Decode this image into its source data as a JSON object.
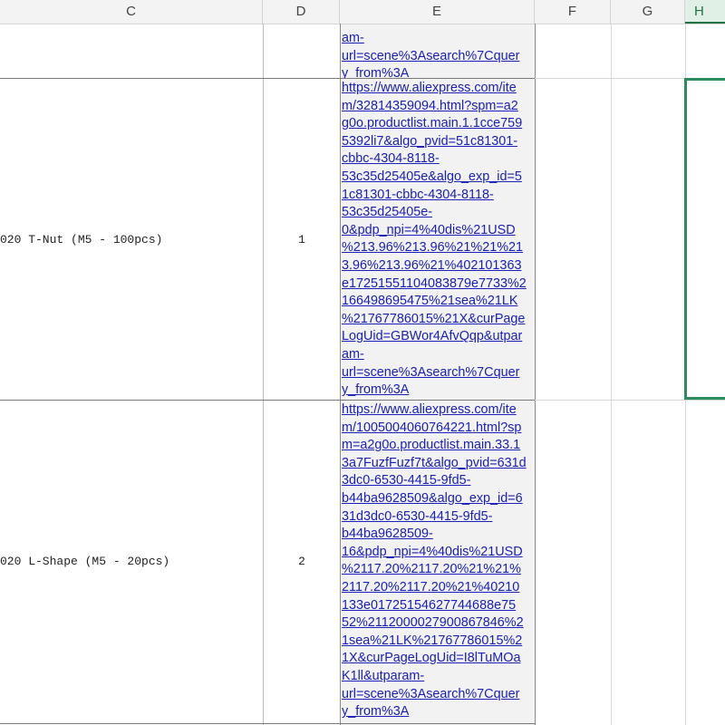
{
  "columns": {
    "c": "C",
    "d": "D",
    "e": "E",
    "f": "F",
    "g": "G",
    "h": "H"
  },
  "rows": [
    {
      "link_fragment": "am-\nurl=scene%3Asearch%7Cquer\ny_from%3A"
    },
    {
      "product": "020 T-Nut (M5 - 100pcs)",
      "quantity": "1",
      "link": "https://www.aliexpress.com/ite\nm/32814359094.html?spm=a2\ng0o.productlist.main.1.1cce759\n5392li7&algo_pvid=51c81301-\ncbbc-4304-8118-\n53c35d25405e&algo_exp_id=5\n1c81301-cbbc-4304-8118-\n53c35d25405e-\n0&pdp_npi=4%40dis%21USD\n%213.96%213.96%21%21%21\n3.96%213.96%21%402101363\ne17251551104083879e7733%2\n166498695475%21sea%21LK\n%21767786015%21X&curPage\nLogUid=GBWor4AfvQqp&utpar\nam-\nurl=scene%3Asearch%7Cquer\ny_from%3A"
    },
    {
      "product": "020 L-Shape (M5 - 20pcs)",
      "quantity": "2",
      "link": "https://www.aliexpress.com/ite\nm/1005004060764221.html?sp\nm=a2g0o.productlist.main.33.1\n3a7FuzfFuzf7t&algo_pvid=631d\n3dc0-6530-4415-9fd5-\nb44ba9628509&algo_exp_id=6\n31d3dc0-6530-4415-9fd5-\nb44ba9628509-\n16&pdp_npi=4%40dis%21USD\n%2117.20%2117.20%21%21%\n2117.20%2117.20%21%40210\n133e01725154627744688e75\n52%2112000027900867846%2\n1sea%21LK%21767786015%2\n1X&curPageLogUid=I8lTuMOa\nK1ll&utparam-\nurl=scene%3Asearch%7Cquer\ny_from%3A"
    }
  ]
}
